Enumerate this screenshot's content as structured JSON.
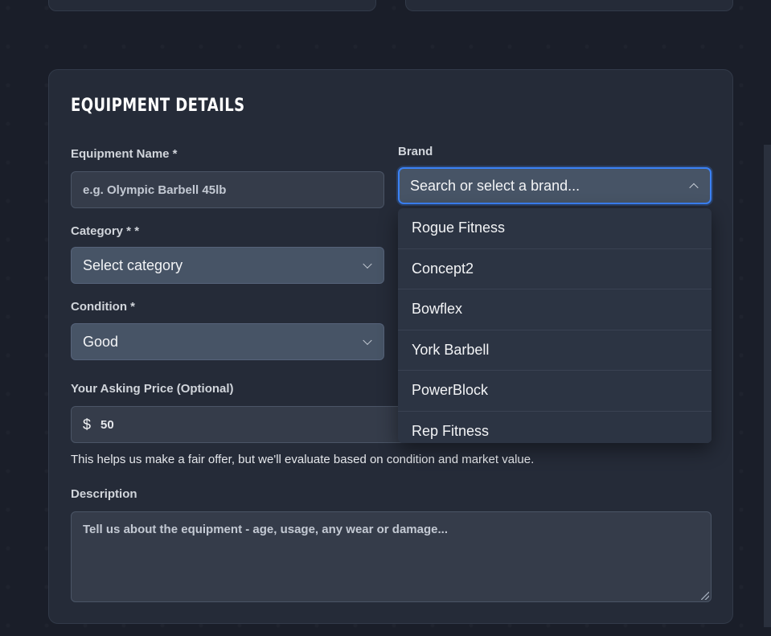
{
  "section": {
    "title": "EQUIPMENT DETAILS"
  },
  "fields": {
    "equipment_name": {
      "label": "Equipment Name *",
      "placeholder": "e.g. Olympic Barbell 45lb"
    },
    "brand": {
      "label": "Brand",
      "placeholder": "Search or select a brand...",
      "options": [
        "Rogue Fitness",
        "Concept2",
        "Bowflex",
        "York Barbell",
        "PowerBlock",
        "Rep Fitness"
      ]
    },
    "category": {
      "label": "Category * *",
      "value": "Select category"
    },
    "condition": {
      "label": "Condition *",
      "value": "Good"
    },
    "price": {
      "label": "Your Asking Price (Optional)",
      "currency": "$",
      "value": "50",
      "help": "This helps us make a fair offer, but we'll evaluate based on condition and market value."
    },
    "description": {
      "label": "Description",
      "placeholder": "Tell us about the equipment - age, usage, any wear or damage..."
    }
  },
  "colors": {
    "background": "#1a1e29",
    "panel": "#252b38",
    "select": "#475466",
    "focus": "#3b82f6"
  }
}
